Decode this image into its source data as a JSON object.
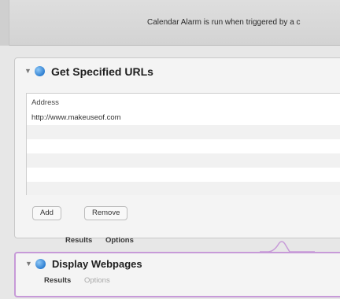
{
  "header": {
    "message": "Calendar Alarm is run when triggered by a c"
  },
  "actions": [
    {
      "title": "Get Specified URLs",
      "table": {
        "column": "Address",
        "rows": [
          "http://www.makeuseof.com"
        ]
      },
      "buttons": {
        "add": "Add",
        "remove": "Remove"
      },
      "tabs": {
        "results": "Results",
        "options": "Options"
      }
    },
    {
      "title": "Display Webpages",
      "tabs": {
        "results": "Results",
        "options": "Options"
      }
    }
  ],
  "colors": {
    "selection_border": "#c79ad8",
    "action_icon": "#2f7fd1"
  },
  "icons": {
    "disclosure": "disclosure-triangle-icon",
    "action": "automator-action-icon"
  }
}
